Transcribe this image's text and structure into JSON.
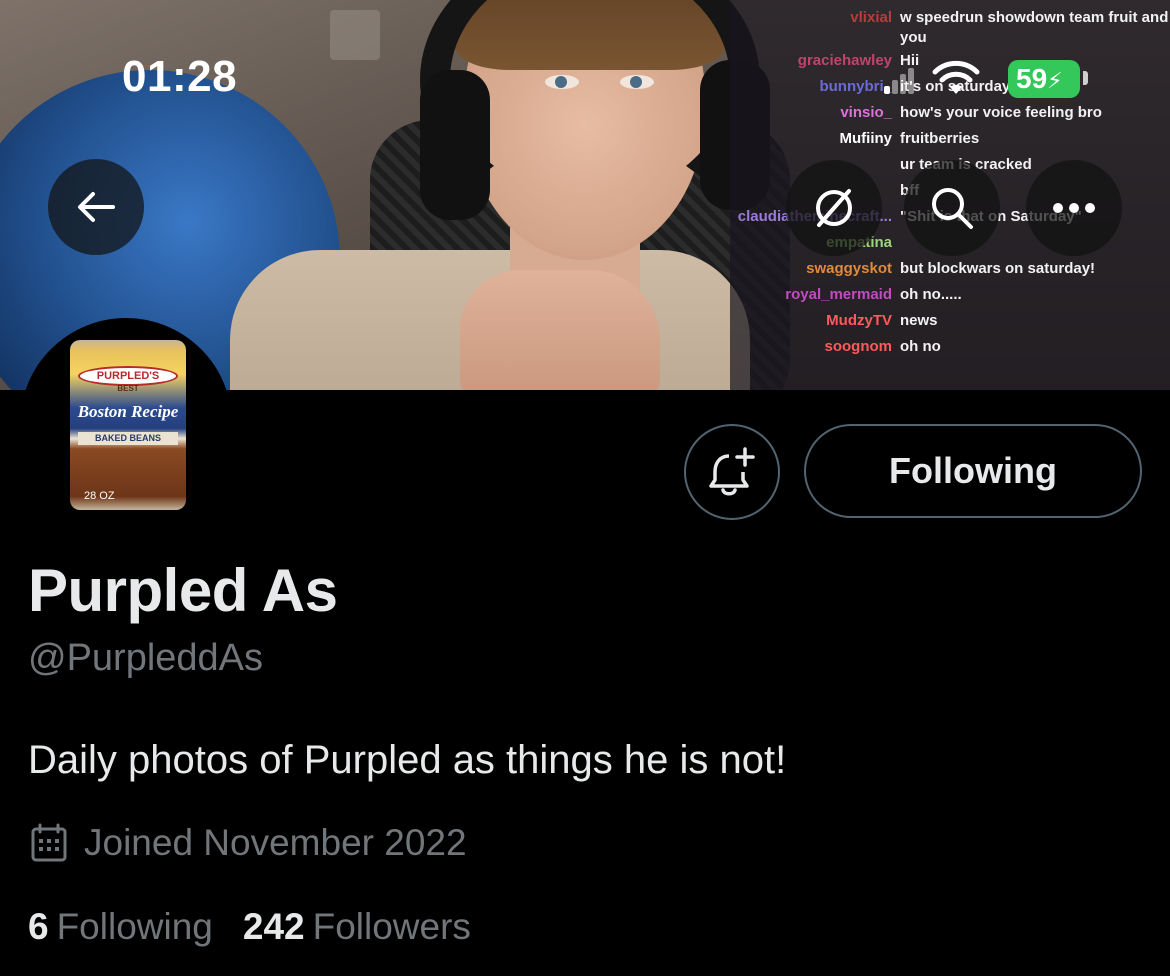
{
  "status_bar": {
    "time": "01:28",
    "battery": "59"
  },
  "banner": {
    "chat": [
      {
        "name": "vlixial",
        "name_color": "#b63d3d",
        "message": "w speedrun showdown team fruit and you",
        "two_line": true
      },
      {
        "name": "graciehawley",
        "name_color": "#c0446c",
        "message": "Hii"
      },
      {
        "name": "bunnybri_",
        "name_color": "#6b6bd8",
        "message": "it's on saturday"
      },
      {
        "name": "vinsio_",
        "name_color": "#d873d8",
        "message": "how's your voice feeling bro"
      },
      {
        "name": "Mufiiny",
        "name_color": "#ffffff",
        "message": "fruitberries"
      },
      {
        "name": "",
        "name_color": "#ffffff",
        "message": "ur team is cracked"
      },
      {
        "name": "",
        "name_color": "#ffffff",
        "message": "bff"
      },
      {
        "name": "claudiatheminecraft...",
        "name_color": "#9b7bd8",
        "message": "\"Shit is that on Saturday\""
      },
      {
        "name": "empatina",
        "name_color": "#9dd67a",
        "message": ""
      },
      {
        "name": "swaggyskot",
        "name_color": "#e08a3a",
        "message": "but blockwars on saturday!"
      },
      {
        "name": "royal_mermaid",
        "name_color": "#c14bc1",
        "message": "oh no....."
      },
      {
        "name": "MudzyTV",
        "name_color": "#ff5a5a",
        "message": "news"
      },
      {
        "name": "soognom",
        "name_color": "#ff5a5a",
        "message": "oh no"
      }
    ]
  },
  "avatar": {
    "brand": "PURPLED'S",
    "best": "BEST",
    "recipe": "Boston Recipe",
    "kind": "BAKED BEANS",
    "oz": "28 OZ"
  },
  "actions": {
    "following_label": "Following"
  },
  "profile": {
    "display_name": "Purpled As",
    "handle": "@PurpleddAs",
    "bio": "Daily photos of Purpled as things he is not!",
    "joined": "Joined November 2022",
    "following_count": "6",
    "following_label": "Following",
    "followers_count": "242",
    "followers_label": "Followers"
  },
  "icons": {
    "back": "back-arrow-icon",
    "no_grok": "slashed-circle-icon",
    "search": "search-icon",
    "more": "more-dots-icon",
    "notify": "bell-plus-icon",
    "calendar": "calendar-icon"
  },
  "colors": {
    "background": "#000000",
    "primary_text": "#e7e9ea",
    "secondary_text": "#71767b",
    "border": "#536471",
    "battery": "#34c759"
  }
}
